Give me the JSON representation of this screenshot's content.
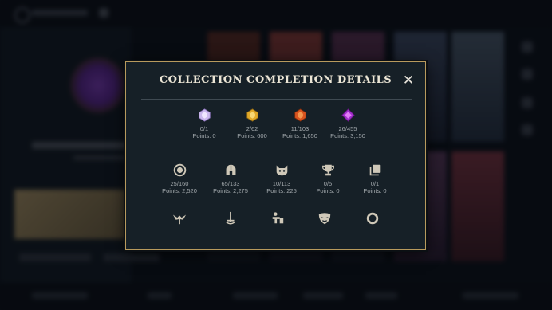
{
  "modal": {
    "title": "COLLECTION COMPLETION DETAILS",
    "close_glyph": "✕"
  },
  "row1": [
    {
      "icon": "purple-crystal-gem-icon",
      "count": "0/1",
      "points": "Points: 0",
      "color": "#d9c9f2"
    },
    {
      "icon": "gold-crystal-gem-icon",
      "count": "2/62",
      "points": "Points: 600",
      "color": "#e7b43a"
    },
    {
      "icon": "orange-crystal-gem-icon",
      "count": "11/103",
      "points": "Points: 1,650",
      "color": "#e0652c"
    },
    {
      "icon": "magenta-crystal-gem-icon",
      "count": "26/455",
      "points": "Points: 3,150",
      "color": "#b43ad6"
    }
  ],
  "row2": [
    {
      "icon": "ring-medal-icon",
      "count": "25/160",
      "points": "Points: 2,520",
      "color": "#cfc8b8"
    },
    {
      "icon": "helmet-icon",
      "count": "65/133",
      "points": "Points: 2,275",
      "color": "#cfc8b8"
    },
    {
      "icon": "poro-icon",
      "count": "10/113",
      "points": "Points: 225",
      "color": "#cfc8b8"
    },
    {
      "icon": "trophy-icon",
      "count": "0/5",
      "points": "Points: 0",
      "color": "#cfc8b8"
    },
    {
      "icon": "stacked-cards-icon",
      "count": "0/1",
      "points": "Points: 0",
      "color": "#cfc8b8"
    }
  ],
  "row3": [
    {
      "icon": "winged-emblem-icon"
    },
    {
      "icon": "sword-icon"
    },
    {
      "icon": "figure-emote-icon"
    },
    {
      "icon": "mask-icon"
    },
    {
      "icon": "ring-icon"
    }
  ]
}
